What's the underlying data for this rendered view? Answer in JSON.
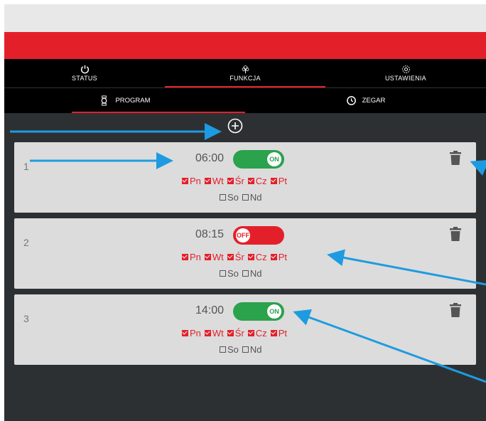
{
  "nav": {
    "tabs": [
      {
        "label": "STATUS",
        "icon": "power-icon",
        "active": false
      },
      {
        "label": "FUNKCJA",
        "icon": "tree-icon",
        "active": true
      },
      {
        "label": "USTAWIENIA",
        "icon": "gear-icon",
        "active": false
      }
    ]
  },
  "subnav": {
    "tabs": [
      {
        "label": "PROGRAM",
        "icon": "watch-icon",
        "active": true
      },
      {
        "label": "ZEGAR",
        "icon": "clock-icon",
        "active": false
      }
    ]
  },
  "programs": [
    {
      "index": "1",
      "time": "06:00",
      "state": "ON",
      "days": [
        {
          "label": "Pn",
          "checked": true
        },
        {
          "label": "Wt",
          "checked": true
        },
        {
          "label": "Śr",
          "checked": true
        },
        {
          "label": "Cz",
          "checked": true
        },
        {
          "label": "Pt",
          "checked": true
        },
        {
          "label": "So",
          "checked": false
        },
        {
          "label": "Nd",
          "checked": false
        }
      ]
    },
    {
      "index": "2",
      "time": "08:15",
      "state": "OFF",
      "days": [
        {
          "label": "Pn",
          "checked": true
        },
        {
          "label": "Wt",
          "checked": true
        },
        {
          "label": "Śr",
          "checked": true
        },
        {
          "label": "Cz",
          "checked": true
        },
        {
          "label": "Pt",
          "checked": true
        },
        {
          "label": "So",
          "checked": false
        },
        {
          "label": "Nd",
          "checked": false
        }
      ]
    },
    {
      "index": "3",
      "time": "14:00",
      "state": "ON",
      "days": [
        {
          "label": "Pn",
          "checked": true
        },
        {
          "label": "Wt",
          "checked": true
        },
        {
          "label": "Śr",
          "checked": true
        },
        {
          "label": "Cz",
          "checked": true
        },
        {
          "label": "Pt",
          "checked": true
        },
        {
          "label": "So",
          "checked": false
        },
        {
          "label": "Nd",
          "checked": false
        }
      ]
    }
  ],
  "colors": {
    "accent": "#e3202a",
    "on": "#2ba24c",
    "annotation": "#1e9be0"
  }
}
